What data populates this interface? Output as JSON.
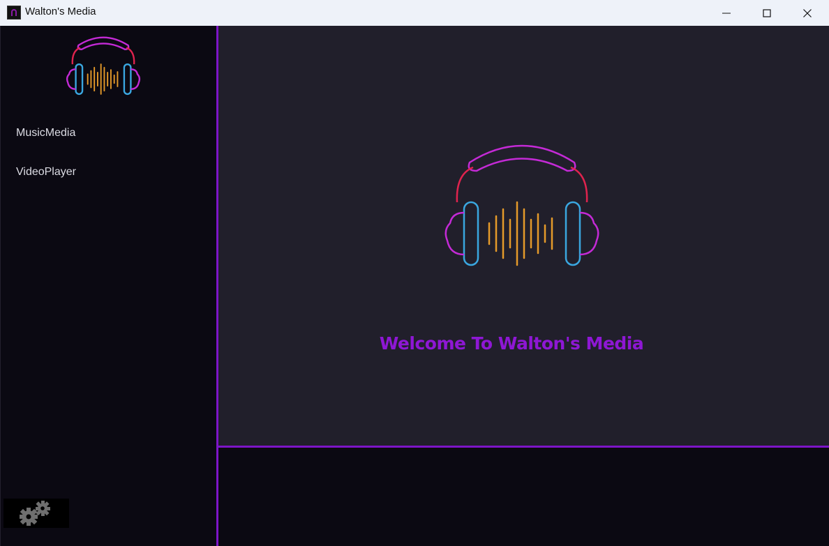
{
  "window": {
    "title": "Walton's Media",
    "controls": [
      "minimize-icon",
      "maximize-icon",
      "close-icon"
    ]
  },
  "sidebar": {
    "logo": "headphones-logo",
    "items": [
      {
        "label": "MusicMedia"
      },
      {
        "label": "VideoPlayer"
      }
    ],
    "settings_icon": "gears-icon"
  },
  "main": {
    "logo": "headphones-logo",
    "welcome_text": "Welcome To Walton's Media"
  },
  "colors": {
    "accent_purple": "#8e17d4",
    "divider_purple": "#7d15c8",
    "logo_magenta": "#c42ad6",
    "logo_red": "#e0234e",
    "logo_blue": "#3aa7e0",
    "logo_orange": "#e59a2a",
    "main_background": "#211f2b",
    "sidebar_background": "#0b0912"
  }
}
